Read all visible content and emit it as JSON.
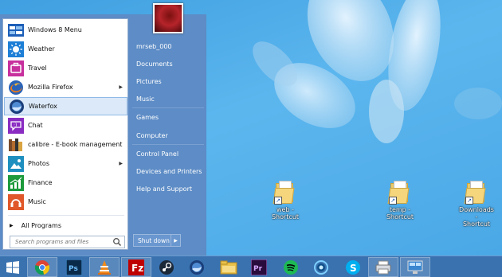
{
  "start_menu": {
    "apps": [
      {
        "label": "Windows 8 Menu",
        "icon": "windows8-menu-icon",
        "submenu": false,
        "selected": false
      },
      {
        "label": "Weather",
        "icon": "weather-icon",
        "submenu": false,
        "selected": false
      },
      {
        "label": "Travel",
        "icon": "travel-icon",
        "submenu": false,
        "selected": false
      },
      {
        "label": "Mozilla Firefox",
        "icon": "firefox-icon",
        "submenu": true,
        "selected": false
      },
      {
        "label": "Waterfox",
        "icon": "waterfox-icon",
        "submenu": false,
        "selected": true
      },
      {
        "label": "Chat",
        "icon": "chat-icon",
        "submenu": false,
        "selected": false
      },
      {
        "label": "calibre - E-book management",
        "icon": "calibre-icon",
        "submenu": false,
        "selected": false
      },
      {
        "label": "Photos",
        "icon": "photos-icon",
        "submenu": true,
        "selected": false
      },
      {
        "label": "Finance",
        "icon": "finance-icon",
        "submenu": false,
        "selected": false
      },
      {
        "label": "Music",
        "icon": "music-icon",
        "submenu": false,
        "selected": false
      }
    ],
    "all_programs": "All Programs",
    "search_placeholder": "Search programs and files",
    "right_items": [
      "mrseb_000",
      "Documents",
      "Pictures",
      "Music",
      "Games",
      "Computer",
      "Control Panel",
      "Devices and Printers",
      "Help and Support"
    ],
    "shutdown_label": "Shut down"
  },
  "desktop_icons": [
    {
      "label": "web -\nShortcut"
    },
    {
      "label": "temp -\nShortcut"
    },
    {
      "label": "Downloads -\nShortcut"
    }
  ],
  "taskbar": {
    "items": [
      "start-button-windows-logo-icon",
      "chrome-icon",
      "photoshop-icon",
      "vlc-icon",
      "filezilla-icon",
      "steam-icon",
      "waterfox-icon",
      "file-explorer-icon",
      "premiere-icon",
      "spotify-icon",
      "network-app-icon",
      "skype-icon",
      "printer-icon",
      "remote-desktop-icon"
    ]
  },
  "colors": {
    "start_menu_blue": "#5d8cc6",
    "taskbar_blue": "#3a72b0",
    "selection": "#dbe9f8",
    "desktop": "#4aa8e6"
  }
}
